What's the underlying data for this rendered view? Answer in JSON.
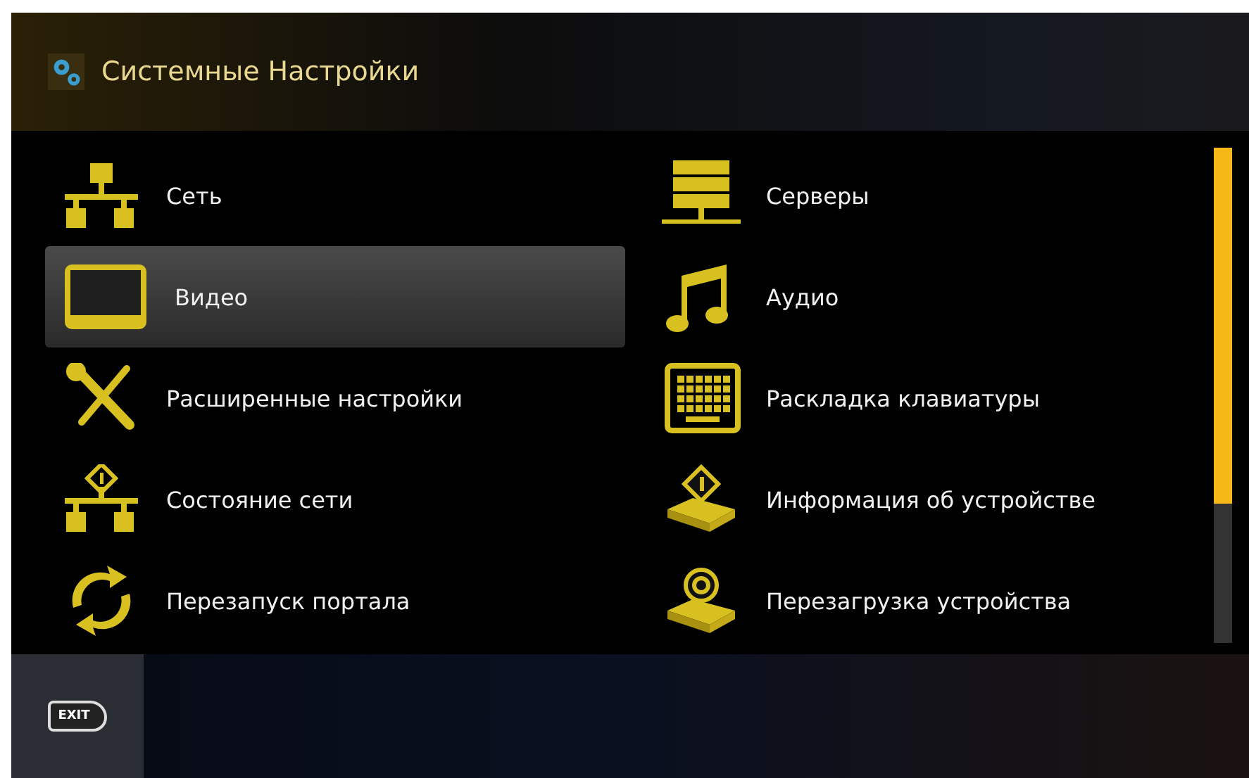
{
  "header": {
    "title": "Системные Настройки"
  },
  "menu": [
    {
      "label": "Сеть",
      "kind": "network",
      "selected": false
    },
    {
      "label": "Серверы",
      "kind": "servers",
      "selected": false
    },
    {
      "label": "Видео",
      "kind": "tv",
      "selected": true
    },
    {
      "label": "Аудио",
      "kind": "music",
      "selected": false
    },
    {
      "label": "Расширенные настройки",
      "kind": "tools",
      "selected": false
    },
    {
      "label": "Раскладка клавиатуры",
      "kind": "keyboard",
      "selected": false
    },
    {
      "label": "Состояние сети",
      "kind": "netinfo",
      "selected": false
    },
    {
      "label": "Информация об устройстве",
      "kind": "devinfo",
      "selected": false
    },
    {
      "label": "Перезапуск портала",
      "kind": "reload",
      "selected": false
    },
    {
      "label": "Перезагрузка устройства",
      "kind": "devreboot",
      "selected": false
    }
  ],
  "footer": {
    "exit_key": "EXIT"
  }
}
